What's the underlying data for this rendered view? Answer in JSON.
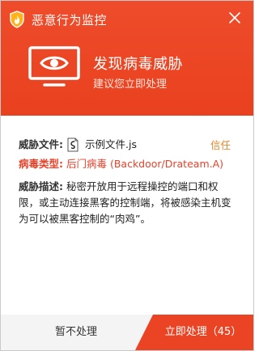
{
  "app": {
    "title": "恶意行为监控"
  },
  "header": {
    "threat_title": "发现病毒威胁",
    "threat_subtitle": "建议您立即处理"
  },
  "details": {
    "file_label": "威胁文件:",
    "file_name": "示例文件.js",
    "trust_link": "信任",
    "type_label": "病毒类型:",
    "type_value": "后门病毒 (Backdoor/Drateam.A)",
    "desc_label": "威胁描述:",
    "desc_text": "秘密开放用于远程操控的端口和权限，或主动连接黑客的控制端，将被感染主机变为可以被黑客控制的“肉鸡”。"
  },
  "footer": {
    "ignore_label": "暂不处理",
    "handle_label": "立即处理（45）",
    "countdown": 45
  },
  "colors": {
    "header_bg": "#eb4623",
    "accent_orange": "#e8872b",
    "danger_red": "#e8422a",
    "footer_bg": "#f4f4f4"
  },
  "icons": {
    "app": "shield-flame-icon",
    "close": "close-icon",
    "monitor": "monitor-eye-icon",
    "file": "js-file-icon"
  }
}
